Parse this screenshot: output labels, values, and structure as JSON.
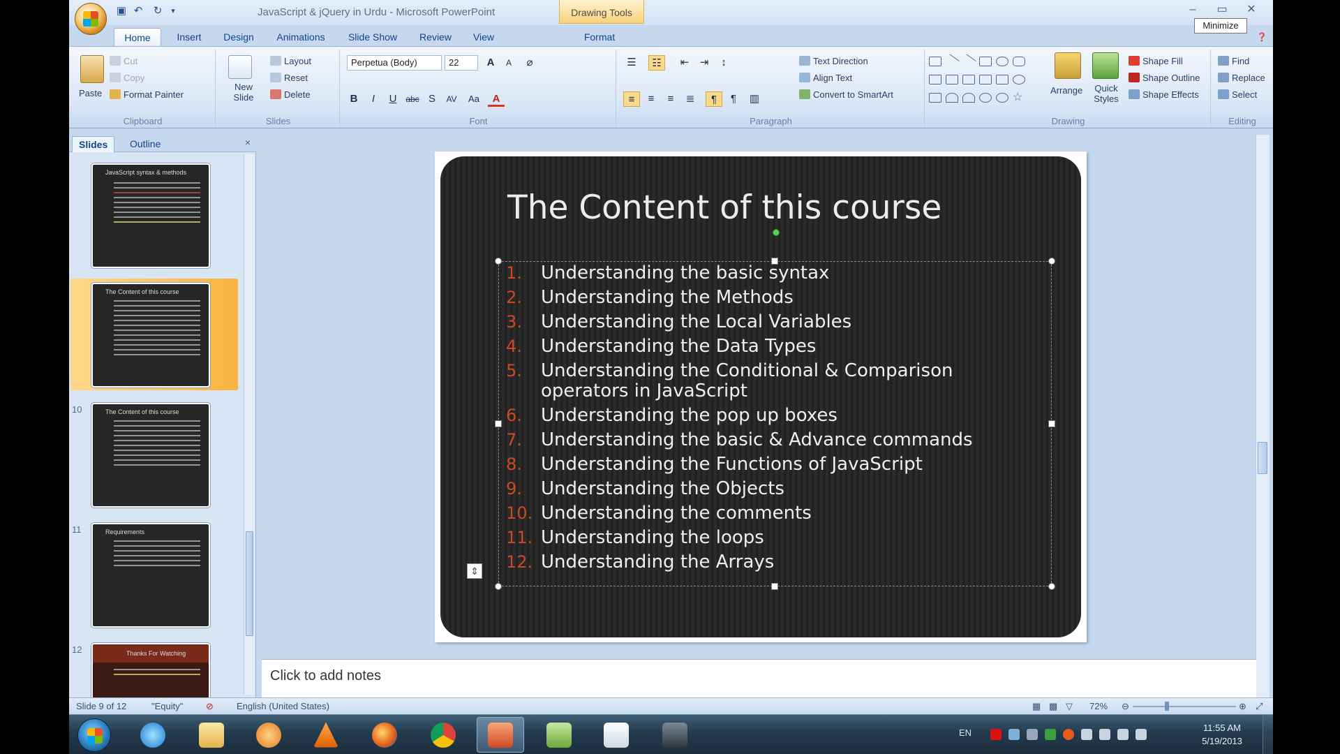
{
  "window": {
    "title": "JavaScript & jQuery in Urdu - Microsoft PowerPoint",
    "contextual_tab": "Drawing Tools",
    "tooltip": "Minimize"
  },
  "tabs": [
    "Home",
    "Insert",
    "Design",
    "Animations",
    "Slide Show",
    "Review",
    "View",
    "Format"
  ],
  "ribbon": {
    "clipboard": {
      "label": "Clipboard",
      "paste": "Paste",
      "cut": "Cut",
      "copy": "Copy",
      "format_painter": "Format Painter"
    },
    "slides": {
      "label": "Slides",
      "new_slide": "New Slide",
      "layout": "Layout",
      "reset": "Reset",
      "delete": "Delete"
    },
    "font": {
      "label": "Font",
      "family": "Perpetua (Body)",
      "size": "22"
    },
    "paragraph": {
      "label": "Paragraph",
      "text_direction": "Text Direction",
      "align_text": "Align Text",
      "smartart": "Convert to SmartArt"
    },
    "drawing": {
      "label": "Drawing",
      "arrange": "Arrange",
      "quick_styles": "Quick Styles",
      "shape_fill": "Shape Fill",
      "shape_outline": "Shape Outline",
      "shape_effects": "Shape Effects"
    },
    "editing": {
      "label": "Editing",
      "find": "Find",
      "replace": "Replace",
      "select": "Select"
    }
  },
  "pane": {
    "tab_slides": "Slides",
    "tab_outline": "Outline",
    "close": "×",
    "thumbnails": [
      {
        "num": "",
        "title": "JavaScript syntax & methods",
        "selected": false
      },
      {
        "num": "",
        "title": "The Content of this course",
        "selected": true
      },
      {
        "num": "10",
        "title": "The Content of this course",
        "selected": false
      },
      {
        "num": "11",
        "title": "Requirements",
        "selected": false
      },
      {
        "num": "12",
        "title": "Thanks For Watching",
        "selected": false
      }
    ]
  },
  "slide": {
    "title": "The Content of this course",
    "items": [
      {
        "num": "1.",
        "text": "Understanding the basic syntax"
      },
      {
        "num": "2.",
        "text": "Understanding the Methods"
      },
      {
        "num": "3.",
        "text": "Understanding the Local Variables"
      },
      {
        "num": "4.",
        "text": "Understanding the Data Types"
      },
      {
        "num": "5.",
        "text": "Understanding the Conditional & Comparison operators in JavaScript"
      },
      {
        "num": "6.",
        "text": "Understanding the pop up boxes"
      },
      {
        "num": "7.",
        "text": "Understanding the basic & Advance commands"
      },
      {
        "num": "8.",
        "text": "Understanding the Functions of JavaScript"
      },
      {
        "num": "9.",
        "text": "Understanding the Objects"
      },
      {
        "num": "10.",
        "text": "Understanding the comments"
      },
      {
        "num": "11.",
        "text": "Understanding the loops"
      },
      {
        "num": "12.",
        "text": "Understanding the Arrays"
      }
    ]
  },
  "notes": {
    "placeholder": "Click to add notes"
  },
  "status": {
    "slide": "Slide 9 of 12",
    "theme": "\"Equity\"",
    "language": "English (United States)",
    "zoom": "72%"
  },
  "taskbar": {
    "lang": "EN",
    "time": "11:55 AM",
    "date": "5/19/2013"
  },
  "colors": {
    "accent_number": "#c94a25",
    "slide_bg": "#262626",
    "ribbon": "#dbe7f6"
  }
}
